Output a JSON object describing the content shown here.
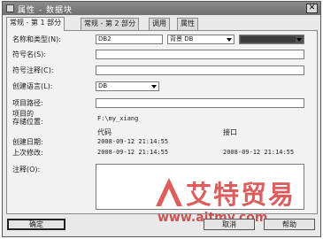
{
  "window": {
    "title": "属性 - 数据块",
    "close_glyph": "✕"
  },
  "tabs": [
    {
      "label": "常规 - 第 1 部分"
    },
    {
      "label": "常规 - 第 2 部分"
    },
    {
      "label": "调用"
    },
    {
      "label": "属性"
    }
  ],
  "form": {
    "name_type_label": "名称和类型(N):",
    "name_value": "DB2",
    "type_value": "背景 DB",
    "type_extra_value": "",
    "symbol_name_label": "符号名(S):",
    "symbol_comment_label": "符号注释(C):",
    "language_label": "创建语言(L):",
    "language_value": "DB",
    "project_path_label": "项目路径:",
    "storage_label_line1": "项目的",
    "storage_label_line2": "存储位置:",
    "storage_value": "F:\\my_xiang",
    "code_header": "代码",
    "interface_header": "接口",
    "created_label": "创建日期:",
    "created_code": "2008-09-12  21:14:55",
    "modified_label": "上次修改:",
    "modified_code": "2008-09-12  21:14:55",
    "modified_interface": "2008-09-12  21:14:55",
    "comment_label": "注释(O):"
  },
  "buttons": {
    "ok": "确定",
    "cancel": "取消",
    "help": "帮助"
  },
  "watermark": {
    "text": "艾特贸易",
    "url": "www.aitmy.com"
  },
  "colors": {
    "titlebar": "#7a7a7a",
    "watermark": "#d84040"
  }
}
